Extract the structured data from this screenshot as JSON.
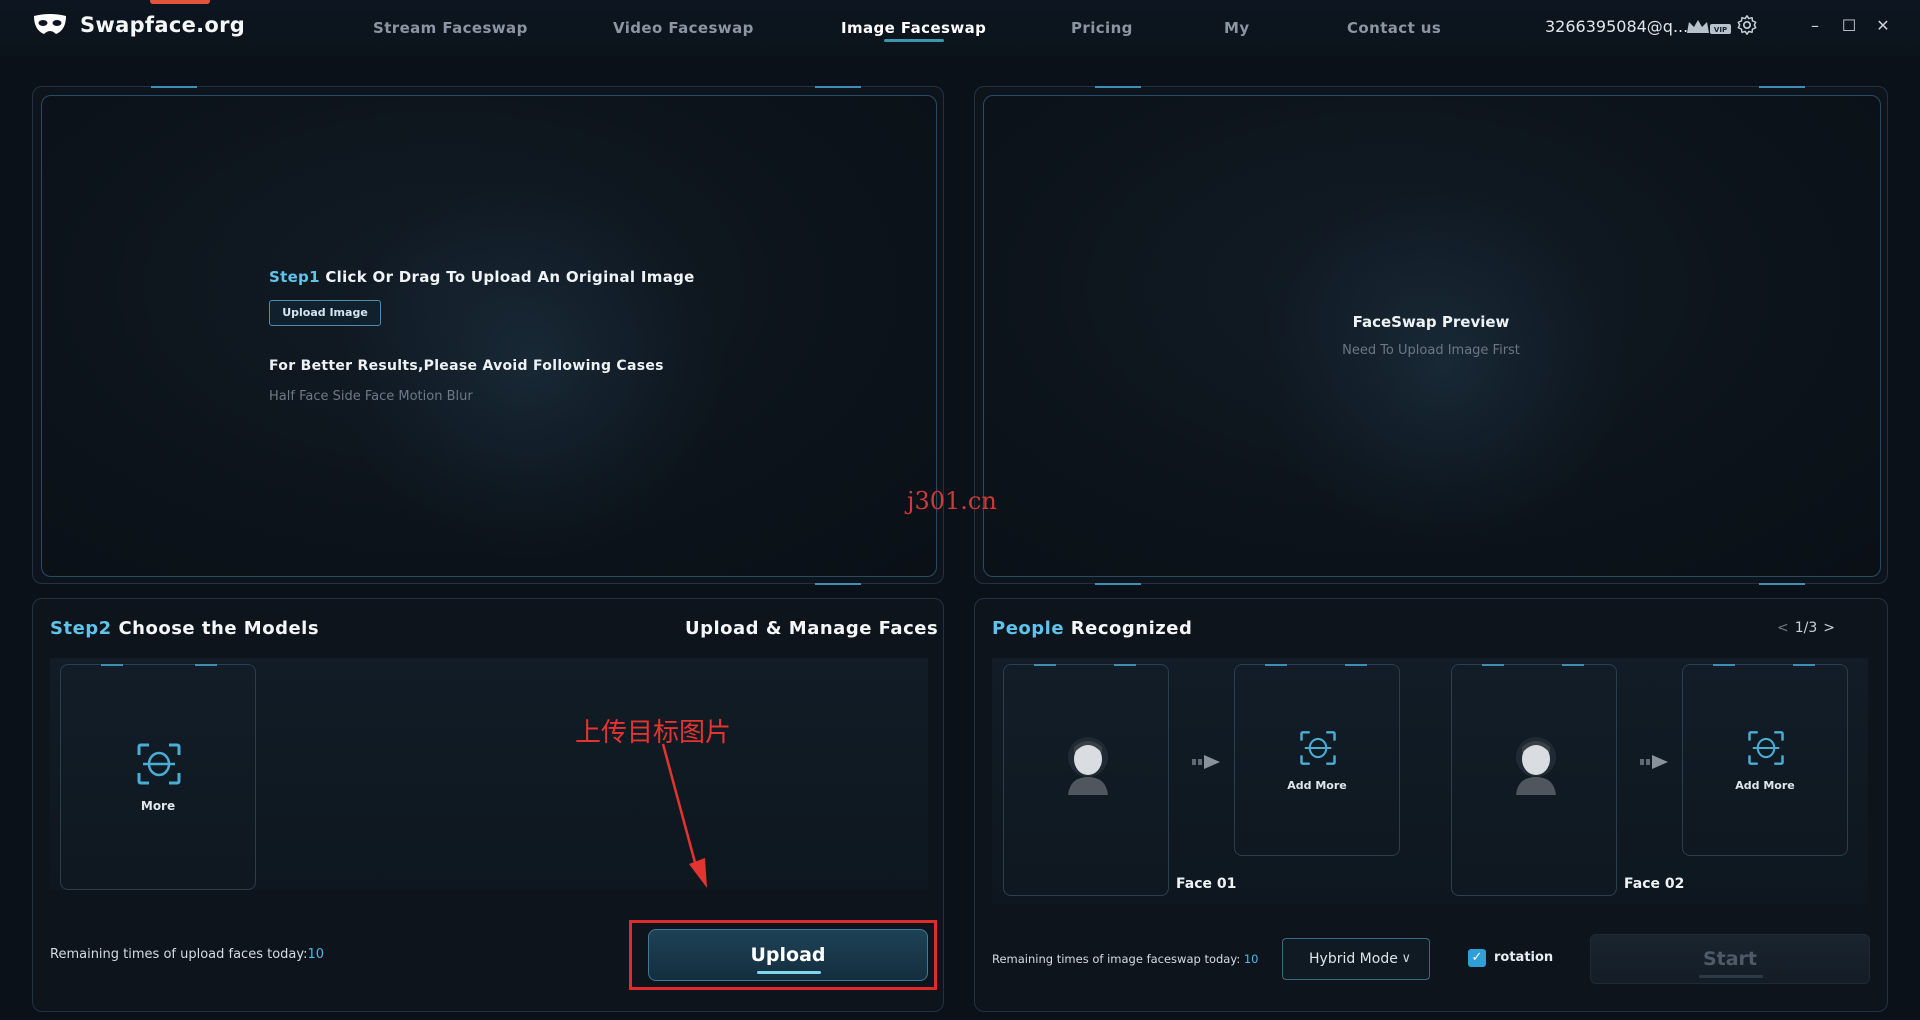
{
  "app": {
    "name": "Swapface.org"
  },
  "nav": [
    {
      "label": "Stream Faceswap",
      "active": false
    },
    {
      "label": "Video Faceswap",
      "active": false
    },
    {
      "label": "Image Faceswap",
      "active": true
    },
    {
      "label": "Pricing",
      "active": false
    },
    {
      "label": "My",
      "active": false
    },
    {
      "label": "Contact us",
      "active": false
    }
  ],
  "account": {
    "email": "3266395084@q...",
    "badge": "VIP"
  },
  "window_controls": {
    "minimize": "–",
    "maximize": "☐",
    "close": "✕"
  },
  "upload_panel": {
    "step_prefix": "Step1",
    "step_text": " Click Or Drag To Upload An Original Image",
    "button": "Upload Image",
    "tips_title": "For Better Results,Please Avoid Following Cases",
    "tips_list": "Half Face Side Face Motion Blur"
  },
  "preview_panel": {
    "title": "FaceSwap Preview",
    "subtitle": "Need To Upload Image First"
  },
  "watermark": "j301.cn",
  "models_panel": {
    "step_prefix": "Step2",
    "step_text": " Choose the Models",
    "right_title": "Upload & Manage Faces",
    "more_label": "More",
    "annotation": "上传目标图片",
    "remaining_label": "Remaining times of upload faces today:",
    "remaining_value": "10",
    "upload_button": "Upload"
  },
  "people_panel": {
    "title_prefix": "People",
    "title_text": " Recognized",
    "pager": "1/3",
    "pager_prev": "<",
    "pager_next": ">",
    "faces": [
      {
        "label": "Face 01",
        "add_more": "Add More"
      },
      {
        "label": "Face 02",
        "add_more": "Add More"
      }
    ],
    "remaining_label": "Remaining times of image faceswap today: ",
    "remaining_value": "10",
    "mode": "Hybrid Mode",
    "rotation_label": "rotation",
    "rotation_checked": true,
    "start_button": "Start"
  },
  "colors": {
    "accent": "#5ec4ea",
    "highlight_red": "#e02b2b",
    "background": "#0b1118"
  }
}
